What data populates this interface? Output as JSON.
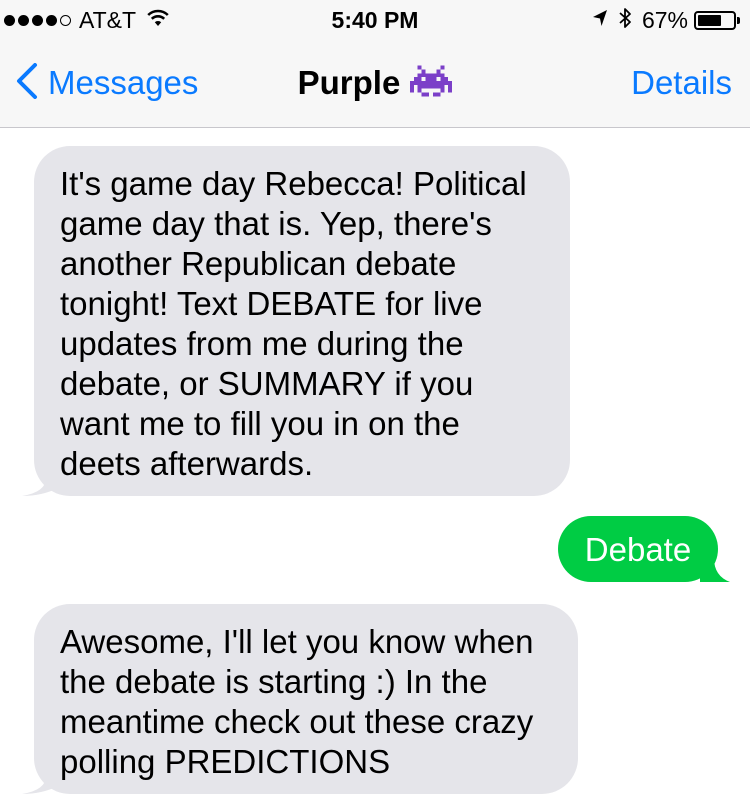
{
  "status_bar": {
    "carrier": "AT&T",
    "signal_strength": 4,
    "signal_max": 5,
    "time": "5:40 PM",
    "battery_percent_label": "67%",
    "battery_level": 0.67,
    "icons": [
      "signal-dots-icon",
      "wifi-icon",
      "location-arrow-icon",
      "bluetooth-icon",
      "battery-icon"
    ]
  },
  "nav": {
    "back_label": "Messages",
    "title": "Purple",
    "title_icon": "alien-monster-icon",
    "details_label": "Details",
    "accent_color": "#0a7aff"
  },
  "messages": [
    {
      "direction": "received",
      "text": "It's game day Rebecca! Political game day that is. Yep, there's another Republican debate tonight! Text DEBATE for live updates from me during the debate, or SUMMARY if you want me to fill you in on the deets afterwards."
    },
    {
      "direction": "sent",
      "text": "Debate"
    },
    {
      "direction": "received",
      "text": "Awesome, I'll let you know when the debate is starting :) In the meantime check out these crazy polling PREDICTIONS"
    }
  ],
  "colors": {
    "received_bubble": "#e5e5ea",
    "sent_bubble": "#00cc44",
    "bar_background": "#f7f7f7"
  }
}
